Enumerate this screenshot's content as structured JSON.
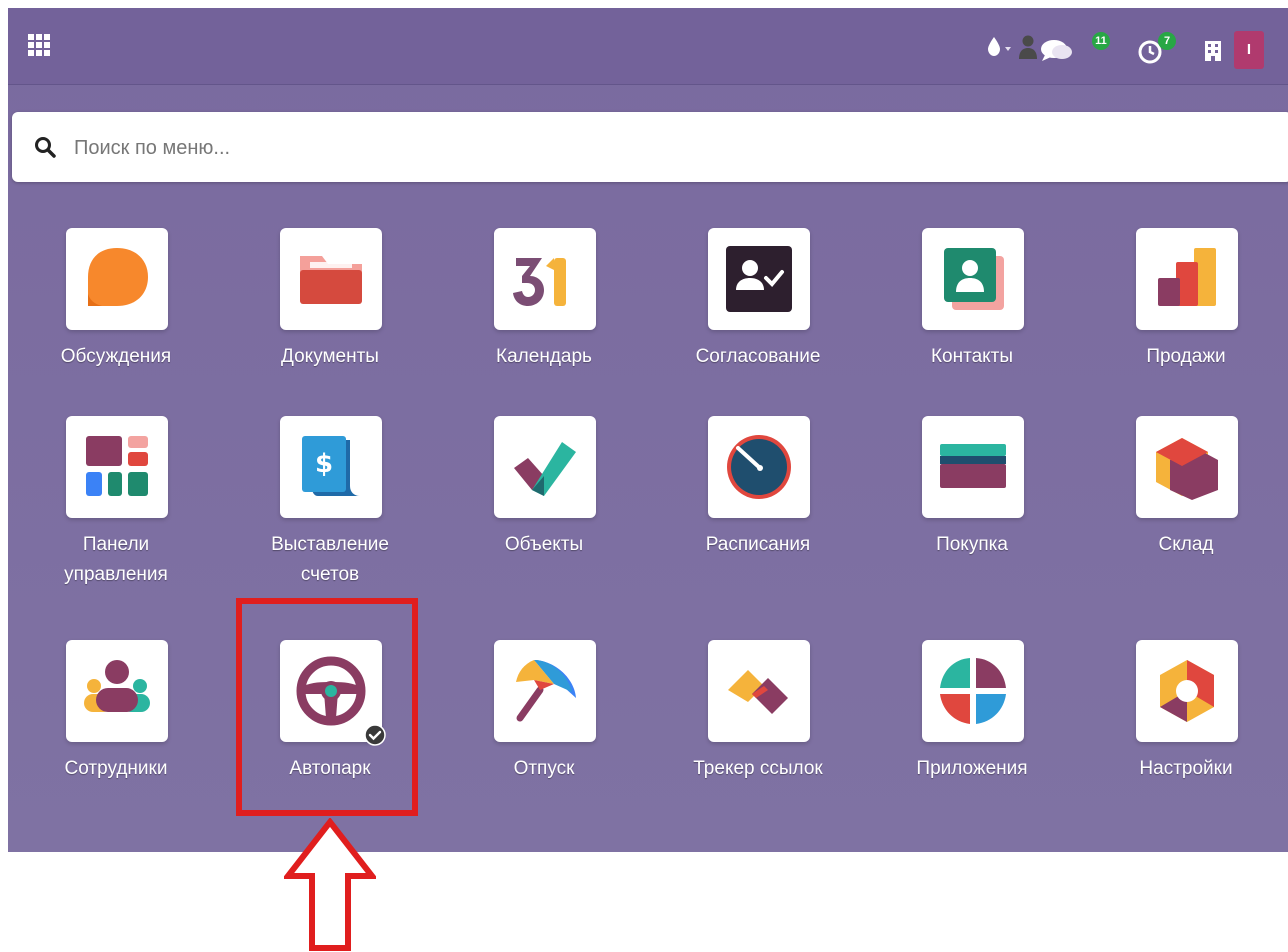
{
  "header": {
    "apps_menu_icon": "apps-grid-icon",
    "systray": {
      "theme_icon": "drop-icon",
      "user_icon": "person-icon",
      "messages_icon": "chat-bubbles-icon",
      "messages_count": "11",
      "activities_icon": "clock-icon",
      "activities_count": "7",
      "company_icon": "building-icon",
      "avatar_initial": "I"
    }
  },
  "search": {
    "placeholder": "Поиск по меню..."
  },
  "apps": [
    {
      "label": "Обсуждения",
      "icon": "discuss-icon"
    },
    {
      "label": "Документы",
      "icon": "documents-folder-icon"
    },
    {
      "label": "Календарь",
      "icon": "calendar-31-icon"
    },
    {
      "label": "Согласование",
      "icon": "approvals-icon"
    },
    {
      "label": "Контакты",
      "icon": "contacts-icon"
    },
    {
      "label": "Продажи",
      "icon": "sales-bars-icon"
    },
    {
      "label": "Панели управления",
      "icon": "dashboards-icon"
    },
    {
      "label": "Выставление счетов",
      "icon": "invoicing-icon"
    },
    {
      "label": "Объекты",
      "icon": "checkmark-icon"
    },
    {
      "label": "Расписания",
      "icon": "gauge-icon"
    },
    {
      "label": "Покупка",
      "icon": "card-icon"
    },
    {
      "label": "Склад",
      "icon": "inventory-cube-icon"
    },
    {
      "label": "Сотрудники",
      "icon": "employees-icon"
    },
    {
      "label": "Автопарк",
      "icon": "steering-wheel-icon"
    },
    {
      "label": "Отпуск",
      "icon": "umbrella-icon"
    },
    {
      "label": "Трекер ссылок",
      "icon": "link-tracker-icon"
    },
    {
      "label": "Приложения",
      "icon": "apps-circle-icon"
    },
    {
      "label": "Настройки",
      "icon": "settings-hexagon-icon"
    }
  ],
  "colors": {
    "navbar": "#73629a",
    "background": "#7a6a9f",
    "badge": "#28a745",
    "avatar": "#b03a6e",
    "annotation": "#e01e1e"
  }
}
